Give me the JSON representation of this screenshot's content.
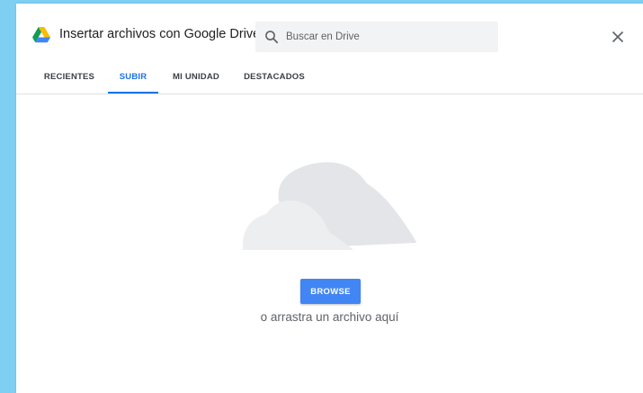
{
  "dialog": {
    "title": "Insertar archivos con Google Drive",
    "search": {
      "placeholder": "Buscar en Drive",
      "value": ""
    },
    "tabs": [
      {
        "label": "RECIENTES",
        "active": false
      },
      {
        "label": "SUBIR",
        "active": true
      },
      {
        "label": "MI UNIDAD",
        "active": false
      },
      {
        "label": "DESTACADOS",
        "active": false
      }
    ],
    "upload": {
      "browse_label": "BROWSE",
      "drop_text": "o arrastra un archivo aquí"
    }
  },
  "colors": {
    "background": "#7ecff2",
    "accent": "#1a73e8",
    "button": "#4285f4",
    "cloud": "#e8eaed"
  },
  "icons": {
    "logo": "google-drive-icon",
    "search": "search-icon",
    "close": "close-icon",
    "illustration": "cloud-icon"
  }
}
